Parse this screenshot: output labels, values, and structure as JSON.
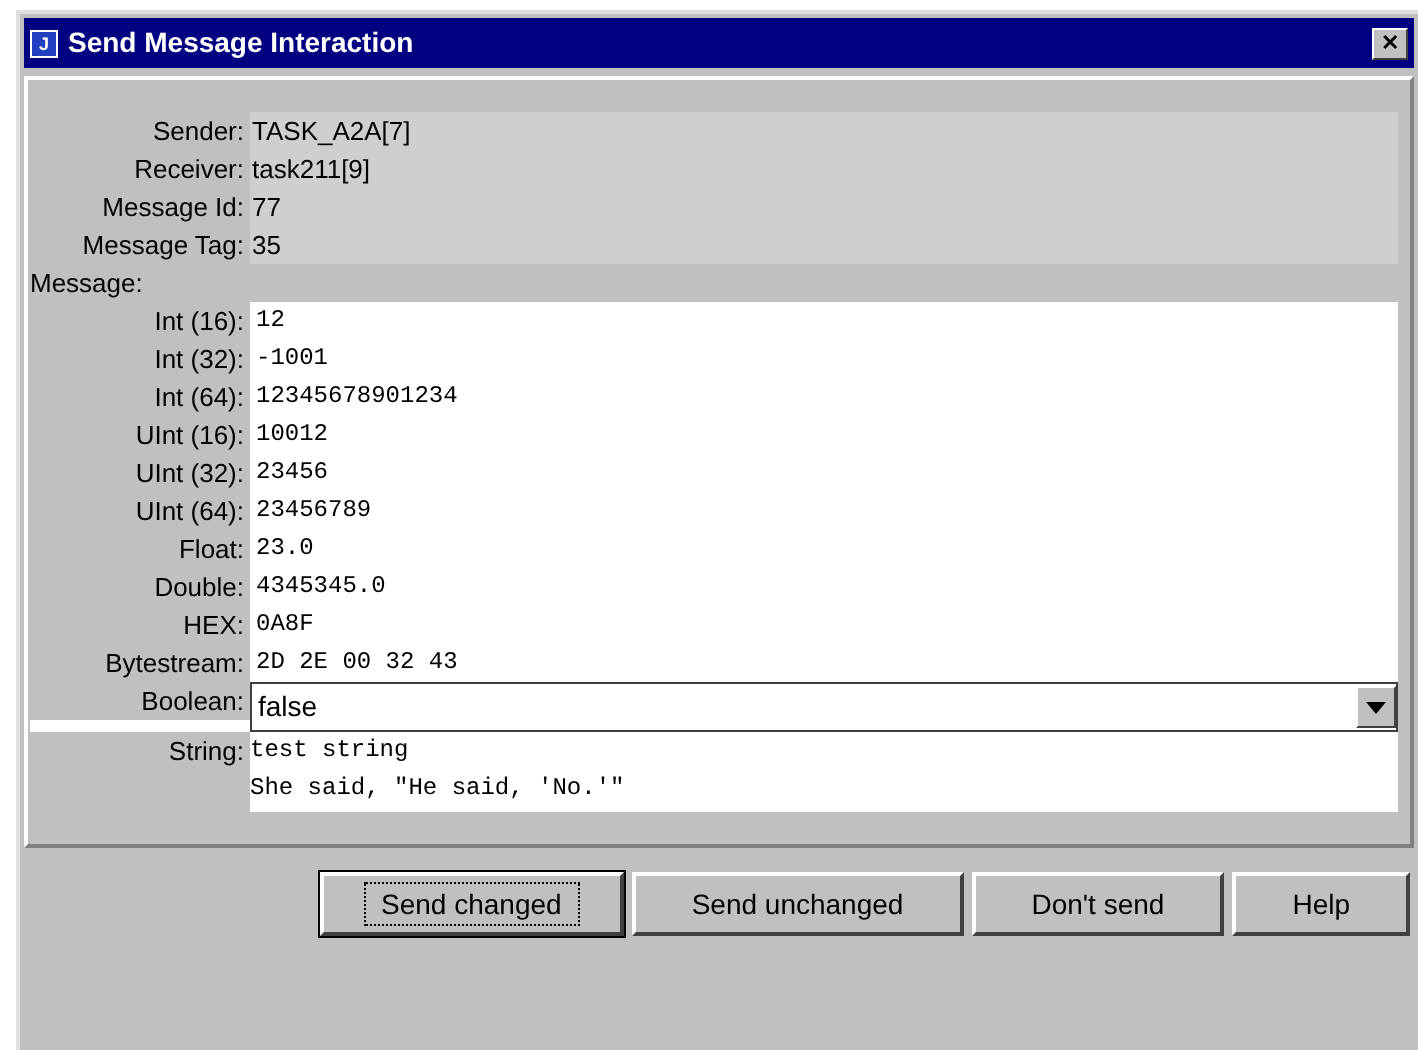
{
  "window": {
    "title": "Send Message Interaction",
    "app_icon": "J",
    "close_glyph": "✕"
  },
  "header": [
    {
      "label": "Sender:",
      "value": "TASK_A2A[7]"
    },
    {
      "label": "Receiver:",
      "value": "task211[9]"
    },
    {
      "label": "Message Id:",
      "value": "77"
    },
    {
      "label": "Message Tag:",
      "value": "35"
    }
  ],
  "message_label": "Message:",
  "fields": [
    {
      "kind": "text",
      "label": "Int (16):",
      "value": "12"
    },
    {
      "kind": "text",
      "label": "Int (32):",
      "value": "-1001"
    },
    {
      "kind": "text",
      "label": "Int (64):",
      "value": "12345678901234"
    },
    {
      "kind": "text",
      "label": "UInt (16):",
      "value": "10012"
    },
    {
      "kind": "text",
      "label": "UInt (32):",
      "value": "23456"
    },
    {
      "kind": "text",
      "label": "UInt (64):",
      "value": "23456789"
    },
    {
      "kind": "text",
      "label": "Float:",
      "value": "23.0"
    },
    {
      "kind": "text",
      "label": "Double:",
      "value": "4345345.0"
    },
    {
      "kind": "text",
      "label": "HEX:",
      "value": "0A8F"
    },
    {
      "kind": "text",
      "label": "Bytestream:",
      "value": "2D 2E 00 32 43"
    },
    {
      "kind": "dropdown",
      "label": "Boolean:",
      "value": "false"
    },
    {
      "kind": "multiline",
      "label": "String:",
      "lines": [
        "test string",
        "She said, \"He said, 'No.'\""
      ]
    }
  ],
  "buttons": [
    {
      "label": "Send changed",
      "focused": true
    },
    {
      "label": "Send unchanged",
      "focused": false
    },
    {
      "label": "Don't send",
      "focused": false
    },
    {
      "label": "Help",
      "focused": false
    }
  ]
}
